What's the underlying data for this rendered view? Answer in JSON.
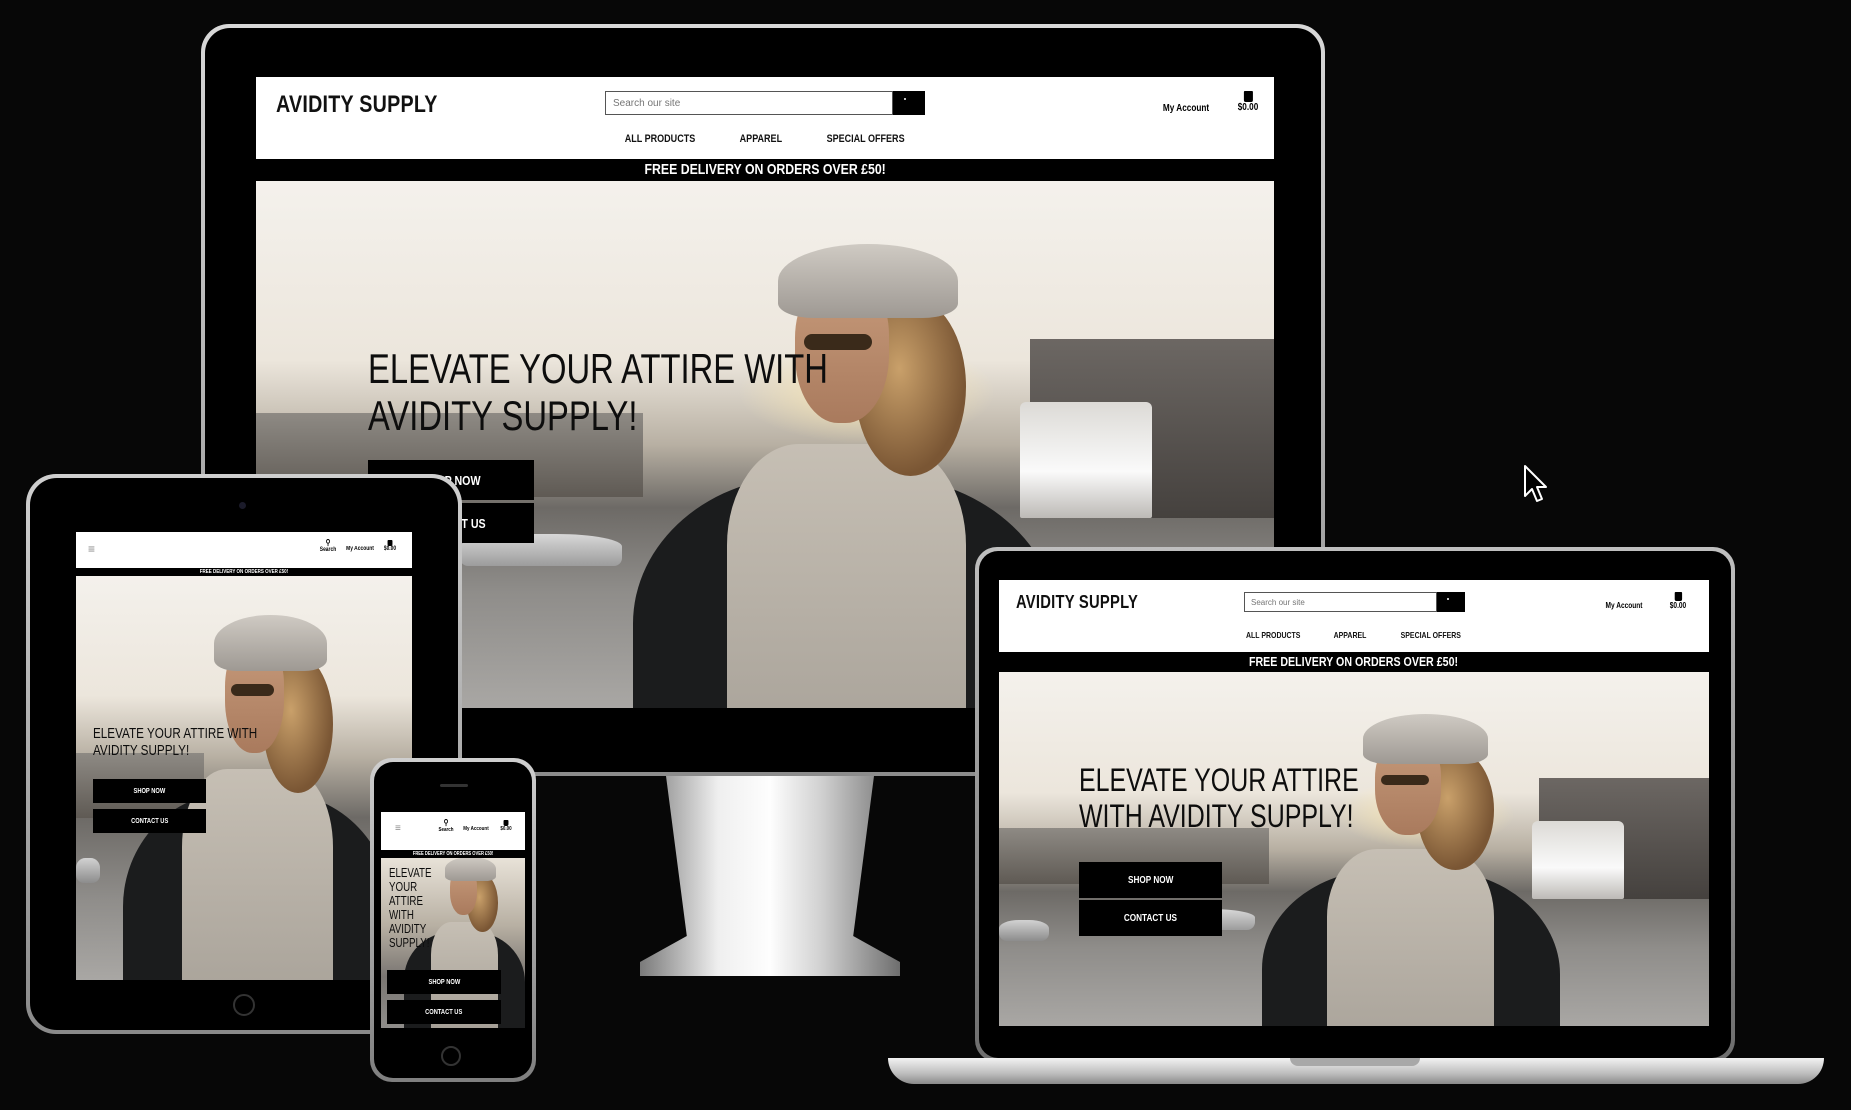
{
  "site": {
    "logo": "AVIDITY SUPPLY",
    "search_placeholder": "Search our site",
    "account_label": "My Account",
    "cart_total": "$0.00",
    "search_label": "Search",
    "nav": [
      "ALL PRODUCTS",
      "APPAREL",
      "SPECIAL OFFERS"
    ],
    "banner": "FREE DELIVERY ON ORDERS OVER £50!",
    "hero_line1": "ELEVATE YOUR ATTIRE WITH",
    "hero_line2": "AVIDITY SUPPLY!",
    "hero_full": "ELEVATE YOUR ATTIRE WITH AVIDITY SUPPLY!",
    "shop_now": "SHOP NOW",
    "contact_us": "CONTACT US"
  },
  "colors": {
    "background": "#070707",
    "bezel": "#000000",
    "accent": "#000000",
    "page": "#ffffff"
  },
  "icons": [
    "search-icon",
    "user-icon",
    "shopping-bag-icon",
    "hamburger-icon",
    "cursor-icon"
  ]
}
